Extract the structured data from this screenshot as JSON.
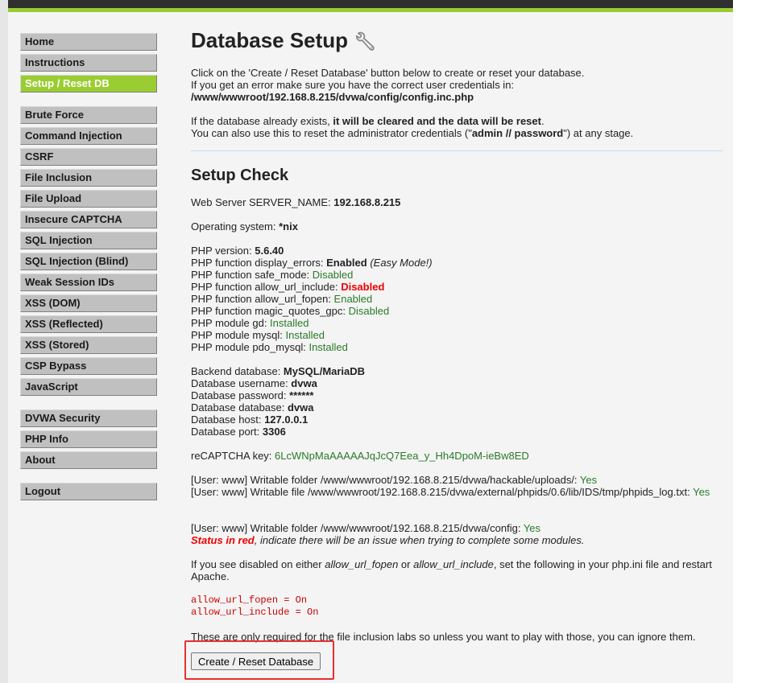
{
  "menu": {
    "groups": [
      [
        "Home",
        "Instructions",
        "Setup / Reset DB"
      ],
      [
        "Brute Force",
        "Command Injection",
        "CSRF",
        "File Inclusion",
        "File Upload",
        "Insecure CAPTCHA",
        "SQL Injection",
        "SQL Injection (Blind)",
        "Weak Session IDs",
        "XSS (DOM)",
        "XSS (Reflected)",
        "XSS (Stored)",
        "CSP Bypass",
        "JavaScript"
      ],
      [
        "DVWA Security",
        "PHP Info",
        "About"
      ],
      [
        "Logout"
      ]
    ],
    "selected": "Setup / Reset DB"
  },
  "title": "Database Setup",
  "intro": {
    "l1": "Click on the 'Create / Reset Database' button below to create or reset your database.",
    "l2": "If you get an error make sure you have the correct user credentials in:",
    "path": "/www/wwwroot/192.168.8.215/dvwa/config/config.inc.php",
    "p2a": "If the database already exists, ",
    "p2b": "it will be cleared and the data will be reset",
    "p2c": ".",
    "p3a": "You can also use this to reset the administrator credentials (\"",
    "p3b": "admin // password",
    "p3c": "\") at any stage."
  },
  "check": {
    "title": "Setup Check",
    "server_label": "Web Server SERVER_NAME: ",
    "server": "192.168.8.215",
    "os_label": "Operating system: ",
    "os": "*nix",
    "php": [
      {
        "label": "PHP version: ",
        "value": "5.6.40",
        "cls": "b"
      },
      {
        "label": "PHP function display_errors: ",
        "value": "Enabled",
        "cls": "b",
        "extra": " (Easy Mode!)"
      },
      {
        "label": "PHP function safe_mode: ",
        "value": "Disabled",
        "cls": "g"
      },
      {
        "label": "PHP function allow_url_include: ",
        "value": "Disabled",
        "cls": "r"
      },
      {
        "label": "PHP function allow_url_fopen: ",
        "value": "Enabled",
        "cls": "g"
      },
      {
        "label": "PHP function magic_quotes_gpc: ",
        "value": "Disabled",
        "cls": "g"
      },
      {
        "label": "PHP module gd: ",
        "value": "Installed",
        "cls": "g"
      },
      {
        "label": "PHP module mysql: ",
        "value": "Installed",
        "cls": "g"
      },
      {
        "label": "PHP module pdo_mysql: ",
        "value": "Installed",
        "cls": "g"
      }
    ],
    "db": [
      {
        "label": "Backend database: ",
        "value": "MySQL/MariaDB"
      },
      {
        "label": "Database username: ",
        "value": "dvwa"
      },
      {
        "label": "Database password: ",
        "value": "******"
      },
      {
        "label": "Database database: ",
        "value": "dvwa"
      },
      {
        "label": "Database host: ",
        "value": "127.0.0.1"
      },
      {
        "label": "Database port: ",
        "value": "3306"
      }
    ],
    "recaptcha_label": "reCAPTCHA key: ",
    "recaptcha": "6LcWNpMaAAAAAJqJcQ7Eea_y_Hh4DpoM-ieBw8ED",
    "w1": "[User: www] Writable folder /www/wwwroot/192.168.8.215/dvwa/hackable/uploads/: ",
    "w2": "[User: www] Writable file /www/wwwroot/192.168.8.215/dvwa/external/phpids/0.6/lib/IDS/tmp/phpids_log.txt: ",
    "w3": "[User: www] Writable folder /www/wwwroot/192.168.8.215/dvwa/config: ",
    "yes": "Yes",
    "status_red": "Status in red",
    "status_rest": ", indicate there will be an issue when trying to complete some modules.",
    "dis1": "If you see disabled on either ",
    "dis_fopen": "allow_url_fopen",
    "dis2": " or ",
    "dis_include": "allow_url_include",
    "dis3": ", set the following in your php.ini file and restart Apache.",
    "code1": "allow_url_fopen = On",
    "code2": "allow_url_include = On",
    "note": "These are only required for the file inclusion labs so unless you want to play with those, you can ignore them."
  },
  "button": "Create / Reset Database"
}
